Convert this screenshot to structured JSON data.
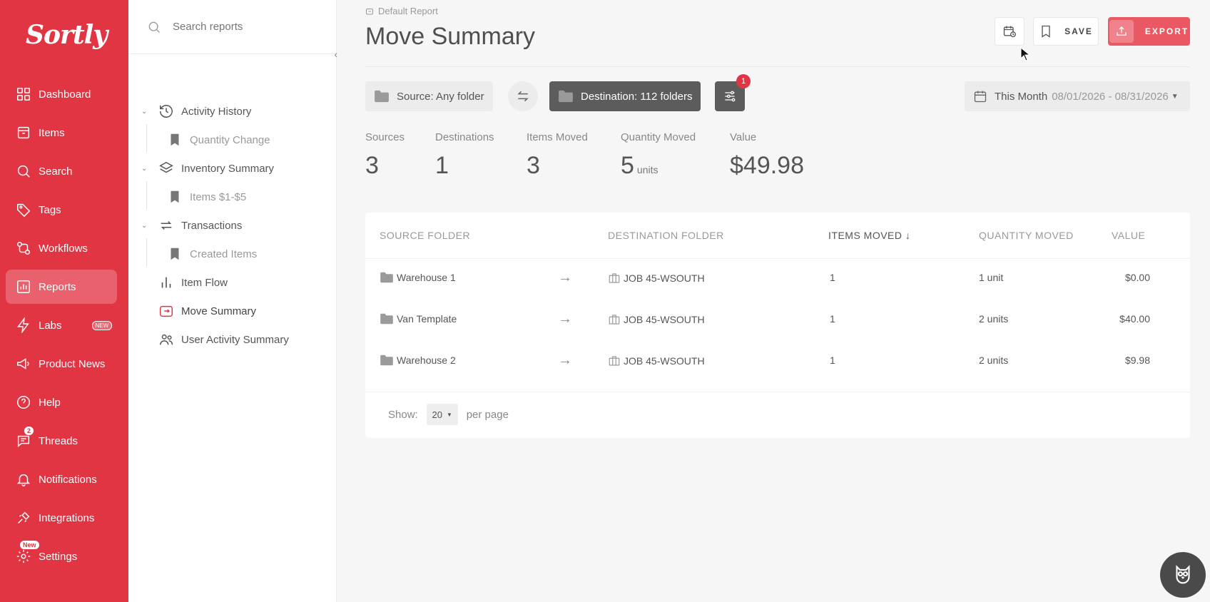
{
  "brand": {
    "name": "Sortly",
    "color": "#e23543"
  },
  "nav": {
    "items": [
      {
        "label": "Dashboard",
        "icon": "dashboard-icon"
      },
      {
        "label": "Items",
        "icon": "items-icon"
      },
      {
        "label": "Search",
        "icon": "search-icon"
      },
      {
        "label": "Tags",
        "icon": "tag-icon"
      },
      {
        "label": "Workflows",
        "icon": "workflow-icon"
      },
      {
        "label": "Reports",
        "icon": "reports-icon",
        "active": true
      },
      {
        "label": "Labs",
        "icon": "bolt-icon",
        "tag": "NEW"
      },
      {
        "label": "Product News",
        "icon": "megaphone-icon"
      },
      {
        "label": "Help",
        "icon": "help-icon"
      },
      {
        "label": "Threads",
        "icon": "threads-icon",
        "badge": "2"
      },
      {
        "label": "Notifications",
        "icon": "bell-icon"
      },
      {
        "label": "Integrations",
        "icon": "plug-icon"
      },
      {
        "label": "Settings",
        "icon": "gear-icon",
        "badge": "New"
      }
    ]
  },
  "tree": {
    "search_placeholder": "Search reports",
    "nodes": [
      {
        "label": "Activity History",
        "icon": "history-icon"
      },
      {
        "label": "Quantity Change",
        "icon": "bookmark-icon",
        "sub": true
      },
      {
        "label": "Inventory Summary",
        "icon": "layers-icon"
      },
      {
        "label": "Items $1-$5",
        "icon": "bookmark-icon",
        "sub": true
      },
      {
        "label": "Transactions",
        "icon": "transactions-icon"
      },
      {
        "label": "Created Items",
        "icon": "bookmark-icon",
        "sub": true
      },
      {
        "label": "Item Flow",
        "icon": "bar-chart-icon"
      },
      {
        "label": "Move Summary",
        "icon": "move-icon",
        "selected": true
      },
      {
        "label": "User Activity Summary",
        "icon": "users-icon"
      }
    ]
  },
  "header": {
    "breadcrumb": "Default Report",
    "title": "Move Summary",
    "save_label": "SAVE",
    "export_label": "EXPORT"
  },
  "filters": {
    "source": "Source: Any folder",
    "destination": "Destination: 112 folders",
    "filter_badge": "1",
    "date_preset": "This Month",
    "date_range": "08/01/2026 - 08/31/2026"
  },
  "stats": [
    {
      "label": "Sources",
      "value": "3"
    },
    {
      "label": "Destinations",
      "value": "1"
    },
    {
      "label": "Items Moved",
      "value": "3"
    },
    {
      "label": "Quantity Moved",
      "value": "5",
      "unit": "units"
    },
    {
      "label": "Value",
      "value": "$49.98"
    }
  ],
  "table": {
    "columns": [
      "SOURCE FOLDER",
      "DESTINATION FOLDER",
      "ITEMS MOVED",
      "QUANTITY MOVED",
      "VALUE"
    ],
    "rows": [
      {
        "source": "Warehouse 1",
        "destination": "JOB 45-WSOUTH",
        "items": "1",
        "quantity": "1 unit",
        "value": "$0.00"
      },
      {
        "source": "Van Template",
        "destination": "JOB 45-WSOUTH",
        "items": "1",
        "quantity": "2 units",
        "value": "$40.00"
      },
      {
        "source": "Warehouse 2",
        "destination": "JOB 45-WSOUTH",
        "items": "1",
        "quantity": "2 units",
        "value": "$9.98"
      }
    ],
    "show_label": "Show:",
    "page_size": "20",
    "per_page_label": "per page"
  }
}
